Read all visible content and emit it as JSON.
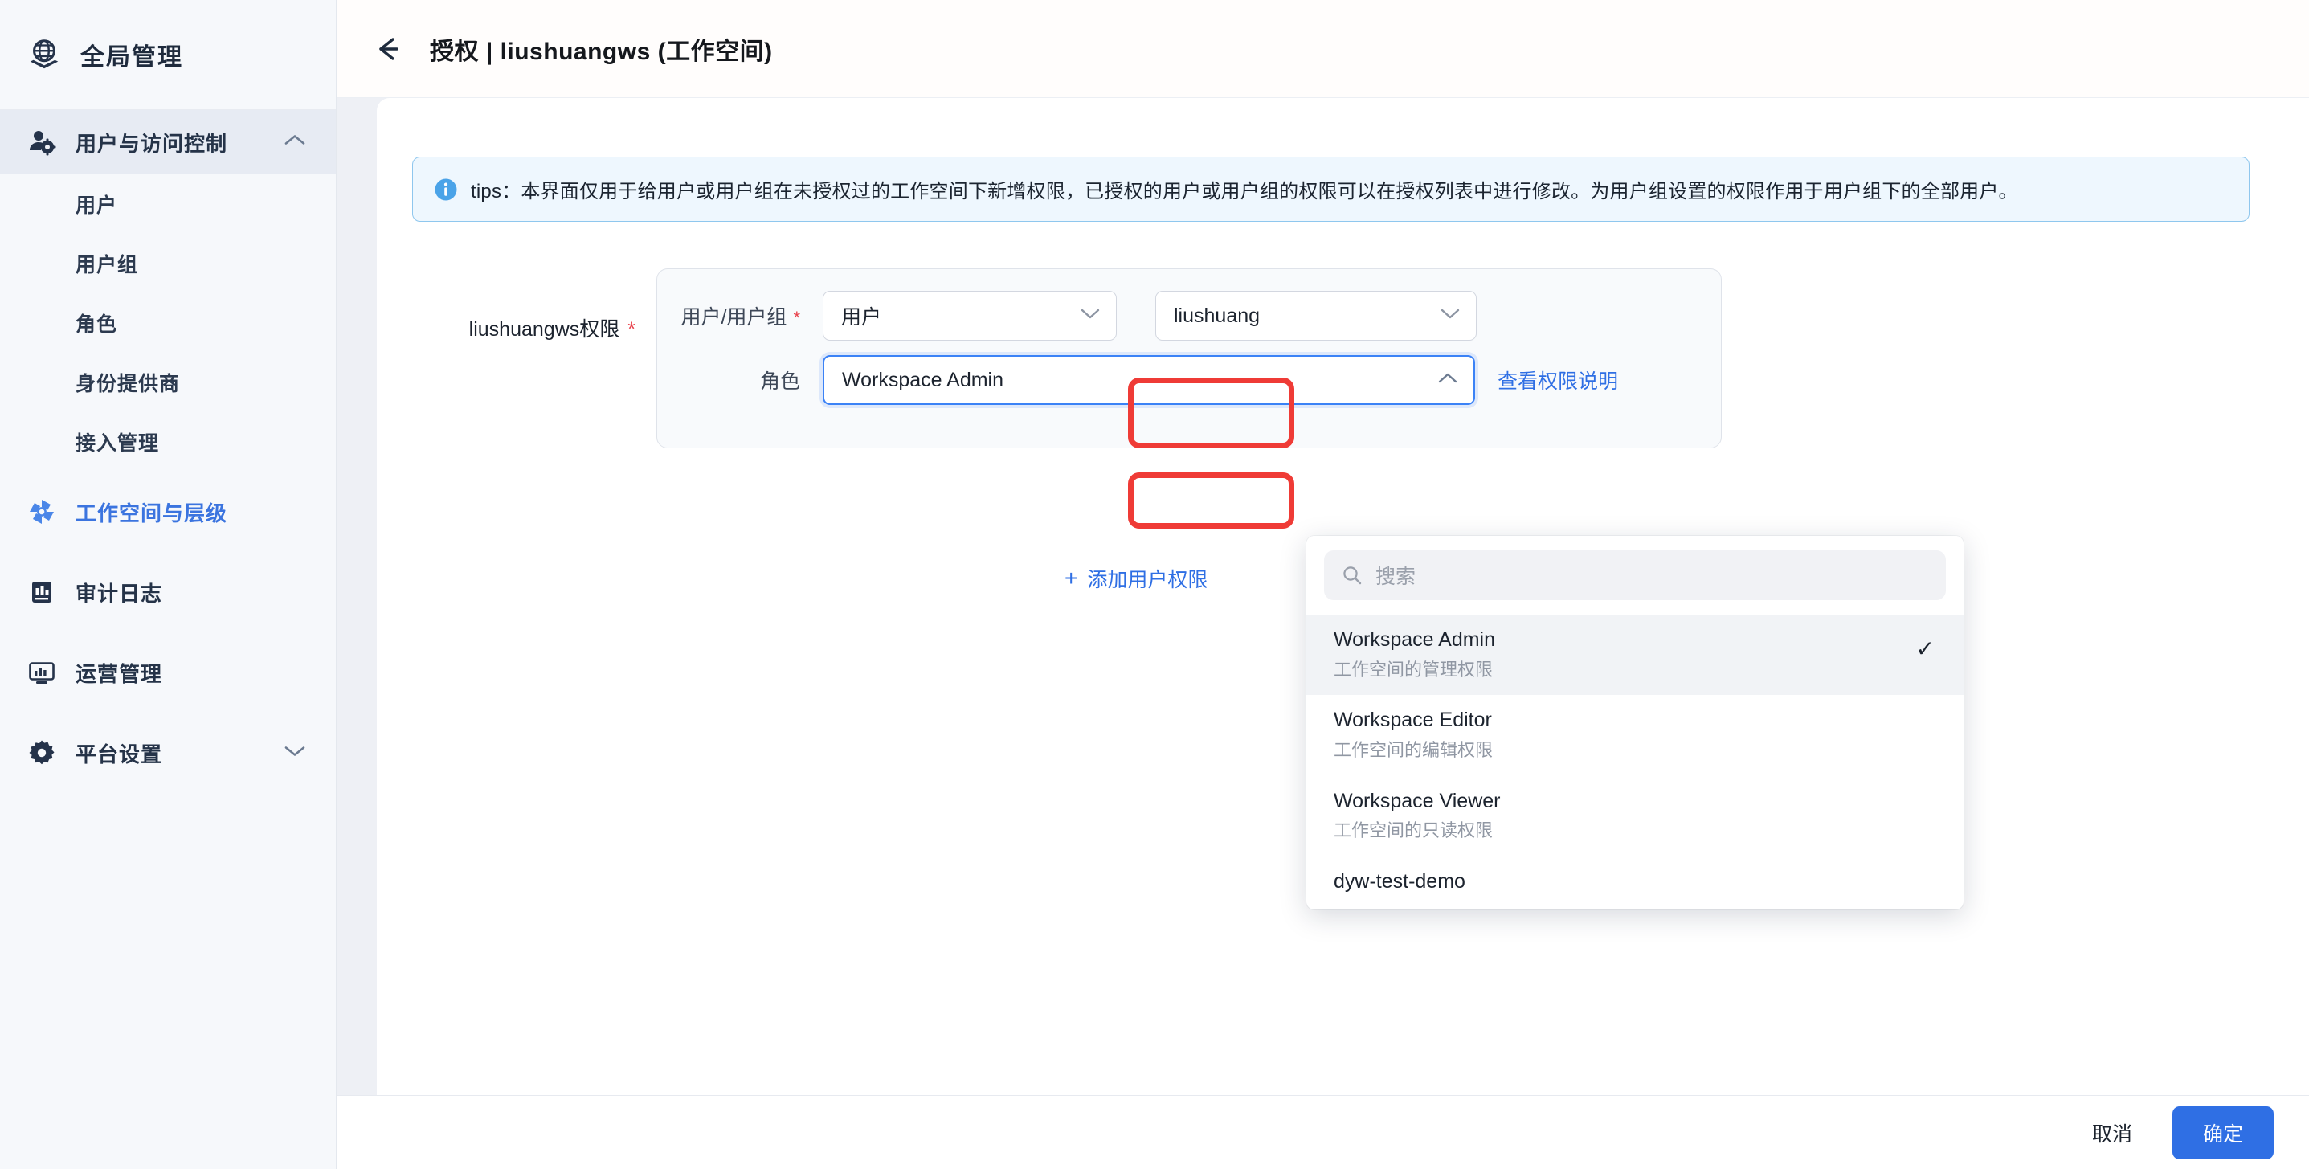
{
  "sidebar": {
    "brand": {
      "title": "全局管理",
      "icon": "globe-layers-icon"
    },
    "group": {
      "label": "用户与访问控制",
      "icon": "user-gear-icon",
      "expanded": true,
      "children": [
        {
          "label": "用户"
        },
        {
          "label": "用户组"
        },
        {
          "label": "角色"
        },
        {
          "label": "身份提供商"
        },
        {
          "label": "接入管理"
        }
      ]
    },
    "items": [
      {
        "label": "工作空间与层级",
        "icon": "pinwheel-icon",
        "active": true
      },
      {
        "label": "审计日志",
        "icon": "audit-chart-icon",
        "active": false
      },
      {
        "label": "运营管理",
        "icon": "monitor-chart-icon",
        "active": false
      },
      {
        "label": "平台设置",
        "icon": "gear-icon",
        "active": false,
        "expandable": true
      }
    ]
  },
  "header": {
    "back_icon": "back-arrow-icon",
    "title": "授权 | liushuangws (工作空间)"
  },
  "tips": {
    "icon": "info-circle-icon",
    "label": "tips：",
    "text": "本界面仅用于给用户或用户组在未授权过的工作空间下新增权限，已授权的用户或用户组的权限可以在授权列表中进行修改。为用户组设置的权限作用于用户组下的全部用户。"
  },
  "form": {
    "label": "liushuangws权限",
    "required_star": "*",
    "rows": [
      {
        "sublabel": "用户/用户组",
        "sublabel_star": "*",
        "type_select": {
          "value": "用户"
        },
        "user_select": {
          "value": "liushuang"
        }
      },
      {
        "sublabel": "角色",
        "role_select": {
          "value": "Workspace Admin"
        },
        "view_permission_link": "查看权限说明"
      }
    ],
    "add_link": {
      "plus": "+",
      "label": "添加用户权限"
    }
  },
  "dropdown": {
    "search": {
      "placeholder": "搜索",
      "icon": "search-icon"
    },
    "check_glyph": "✓",
    "options": [
      {
        "name": "Workspace Admin",
        "desc": "工作空间的管理权限",
        "selected": true
      },
      {
        "name": "Workspace Editor",
        "desc": "工作空间的编辑权限",
        "selected": false
      },
      {
        "name": "Workspace Viewer",
        "desc": "工作空间的只读权限",
        "selected": false
      },
      {
        "name": "dyw-test-demo",
        "desc": "",
        "selected": false
      }
    ]
  },
  "footer": {
    "cancel": "取消",
    "confirm": "确定"
  },
  "colors": {
    "accent": "#2f6fe4",
    "highlight_red": "#ef3b36",
    "tips_bg": "#eef7fe",
    "tips_border": "#8fc7ee",
    "sidebar_bg": "#f6f8fb",
    "active_nav_bg": "#e7ebf3"
  }
}
